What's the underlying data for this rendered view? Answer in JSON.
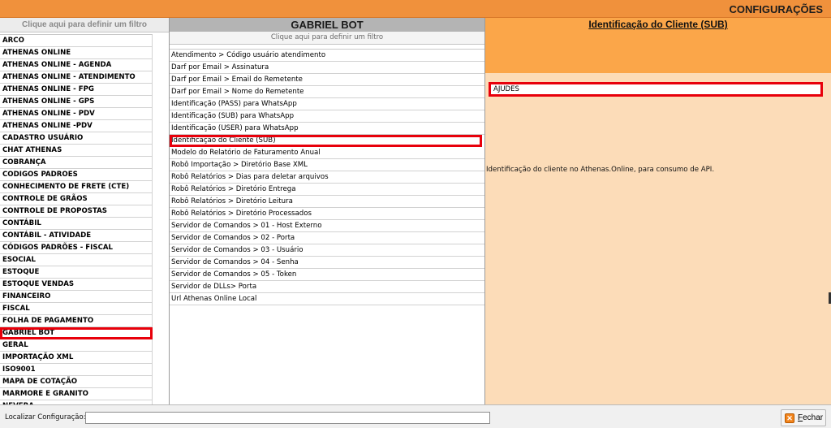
{
  "window": {
    "title": "CONFIGURAÇÕES"
  },
  "categories": {
    "filter_hint": "Clique aqui para definir um filtro",
    "items": [
      "ARCO",
      "ATHENAS ONLINE",
      "ATHENAS ONLINE - AGENDA",
      "ATHENAS ONLINE - ATENDIMENTO",
      "ATHENAS ONLINE - FPG",
      "ATHENAS ONLINE - GPS",
      "ATHENAS ONLINE - PDV",
      "ATHENAS ONLINE -PDV",
      "CADASTRO USUÁRIO",
      "CHAT ATHENAS",
      "COBRANÇA",
      "CODIGOS PADROES",
      "CONHECIMENTO DE FRETE (CTE)",
      "CONTROLE DE GRÃOS",
      "CONTROLE DE PROPOSTAS",
      "CONTÁBIL",
      "CONTÁBIL - ATIVIDADE",
      "CÓDIGOS PADRÕES - FISCAL",
      "ESOCIAL",
      "ESTOQUE",
      "ESTOQUE VENDAS",
      "FINANCEIRO",
      "FISCAL",
      "FOLHA DE PAGAMENTO",
      "GABRIEL BOT",
      "GERAL",
      "IMPORTAÇÃO XML",
      "ISO9001",
      "MAPA DE COTAÇÃO",
      "MARMORE E GRANITO",
      "NFVFRA"
    ],
    "selected_index": 24
  },
  "settings": {
    "title": "GABRIEL BOT",
    "filter_hint": "Clique aqui para definir um filtro",
    "items": [
      "Atendimento > Código usuário atendimento",
      "Darf por Email > Assinatura",
      "Darf por Email > Email do Remetente",
      "Darf por Email > Nome do Remetente",
      "Identificação (PASS) para WhatsApp",
      "Identificação (SUB) para WhatsApp",
      "Identificação (USER) para WhatsApp",
      "Identificação do Cliente (SUB)",
      "Modelo do Relatório de Faturamento Anual",
      "Robô Importação > Diretório Base XML",
      "Robô Relatórios > Dias para deletar arquivos",
      "Robô Relatórios > Diretório Entrega",
      "Robô Relatórios > Diretório Leitura",
      "Robô Relatórios > Diretório Processados",
      "Servidor de Comandos > 01 - Host Externo",
      "Servidor de Comandos > 02 - Porta",
      "Servidor de Comandos > 03 - Usuário",
      "Servidor de Comandos > 04 - Senha",
      "Servidor de Comandos > 05 - Token",
      "Servidor de DLLs> Porta",
      "Url Athenas Online Local"
    ],
    "selected_index": 7
  },
  "detail": {
    "title": "Identificação do Cliente (SUB)",
    "value": "AJUDES",
    "description": "Identificação do cliente no Athenas.Online, para consumo de API."
  },
  "footer": {
    "search_label": "Localizar Configuração:",
    "search_value": "",
    "close_label_first": "F",
    "close_label_rest": "echar",
    "close_icon": "close-icon"
  }
}
